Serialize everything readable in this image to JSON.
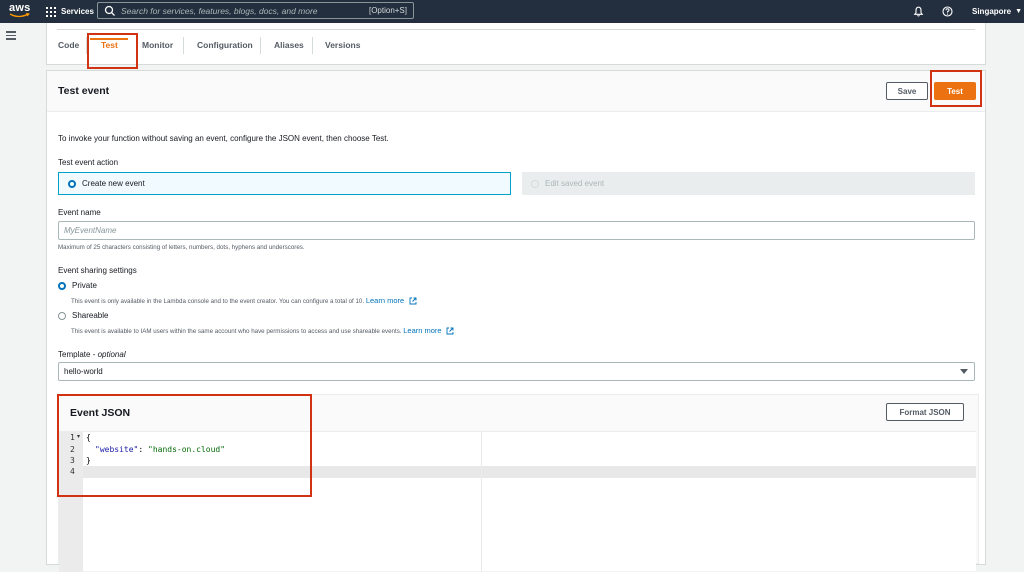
{
  "nav": {
    "logo": "aws",
    "services": "Services",
    "search_placeholder": "Search for services, features, blogs, docs, and more",
    "search_shortcut": "[Option+S]",
    "region": "Singapore"
  },
  "tabs": [
    {
      "label": "Code"
    },
    {
      "label": "Test"
    },
    {
      "label": "Monitor"
    },
    {
      "label": "Configuration"
    },
    {
      "label": "Aliases"
    },
    {
      "label": "Versions"
    }
  ],
  "test_event": {
    "title": "Test event",
    "save_label": "Save",
    "test_label": "Test",
    "intro": "To invoke your function without saving an event, configure the JSON event, then choose Test.",
    "action_label": "Test event action",
    "create_new": "Create new event",
    "edit_saved": "Edit saved event",
    "event_name_label": "Event name",
    "event_name_placeholder": "MyEventName",
    "event_name_hint": "Maximum of 25 characters consisting of letters, numbers, dots, hyphens and underscores.",
    "sharing_label": "Event sharing settings",
    "private_label": "Private",
    "private_desc": "This event is only available in the Lambda console and to the event creator. You can configure a total of 10.",
    "shareable_label": "Shareable",
    "shareable_desc": "This event is available to IAM users within the same account who have permissions to access and use shareable events.",
    "learn_more": "Learn more",
    "template_label": "Template",
    "template_optional": "optional",
    "template_value": "hello-world",
    "json_title": "Event JSON",
    "format_label": "Format JSON"
  },
  "editor": {
    "lines": [
      "1",
      "2",
      "3",
      "4"
    ],
    "code": {
      "l1": "{",
      "key": "\"website\"",
      "colon": ": ",
      "value": "\"hands-on.cloud\"",
      "l3": "}"
    }
  },
  "colors": {
    "nav_bg": "#232f3e",
    "accent": "#ec7211",
    "link": "#0073bb",
    "highlight": "#d13212"
  }
}
